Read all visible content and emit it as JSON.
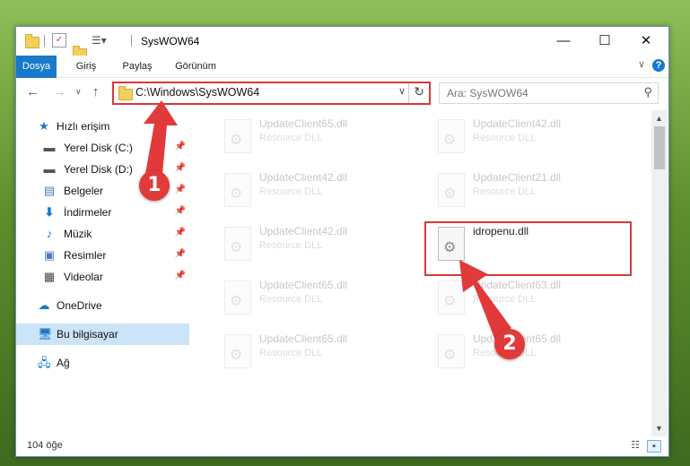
{
  "window": {
    "title": "SysWOW64"
  },
  "titlebar": {
    "minimize": "—",
    "maximize": "☐",
    "close": "✕"
  },
  "ribbon": {
    "tabs": [
      "Dosya",
      "Giriş",
      "Paylaş",
      "Görünüm"
    ],
    "collapse": "∨",
    "help": "?"
  },
  "nav": {
    "back": "←",
    "forward": "→",
    "recent": "∨",
    "up": "↑"
  },
  "address": {
    "path": "C:\\Windows\\SysWOW64",
    "dropdown": "∨",
    "refresh": "↻"
  },
  "search": {
    "placeholder": "Ara: SysWOW64",
    "icon": "⚲"
  },
  "sidebar": {
    "quick_access": "Hızlı erişim",
    "items": [
      {
        "label": "Yerel Disk (C:)",
        "icon": "drive-icon",
        "pinned": true
      },
      {
        "label": "Yerel Disk (D:)",
        "icon": "drive-icon",
        "pinned": true
      },
      {
        "label": "Belgeler",
        "icon": "documents-icon",
        "pinned": true
      },
      {
        "label": "İndirmeler",
        "icon": "download-icon",
        "pinned": true
      },
      {
        "label": "Müzik",
        "icon": "music-icon",
        "pinned": true
      },
      {
        "label": "Resimler",
        "icon": "pictures-icon",
        "pinned": true
      },
      {
        "label": "Videolar",
        "icon": "videos-icon",
        "pinned": true
      }
    ],
    "onedrive": "OneDrive",
    "this_pc": "Bu bilgisayar",
    "network": "Ağ"
  },
  "files": [
    {
      "name": "UpdateClient65.dll",
      "type": "Resource DLL",
      "faded": true
    },
    {
      "name": "UpdateClient42.dll",
      "type": "Resource DLL",
      "faded": true
    },
    {
      "name": "UpdateClient42.dll",
      "type": "Resource DLL",
      "faded": true
    },
    {
      "name": "UpdateClient21.dll",
      "type": "Resource DLL",
      "faded": true
    },
    {
      "name": "UpdateClient42.dll",
      "type": "Resource DLL",
      "faded": true
    },
    {
      "name": "idropenu.dll",
      "type": "",
      "faded": false
    },
    {
      "name": "UpdateClient65.dll",
      "type": "Resource DLL",
      "faded": true
    },
    {
      "name": "UpdateClient63.dll",
      "type": "Resource DLL",
      "faded": true
    },
    {
      "name": "UpdateClient65.dll",
      "type": "Resource DLL",
      "faded": true
    },
    {
      "name": "UpdateClient65.dll",
      "type": "Resource DLL",
      "faded": true
    }
  ],
  "status": {
    "count": "104 öğe"
  },
  "annotations": {
    "step1": "1",
    "step2": "2",
    "color": "#e23a3b"
  }
}
